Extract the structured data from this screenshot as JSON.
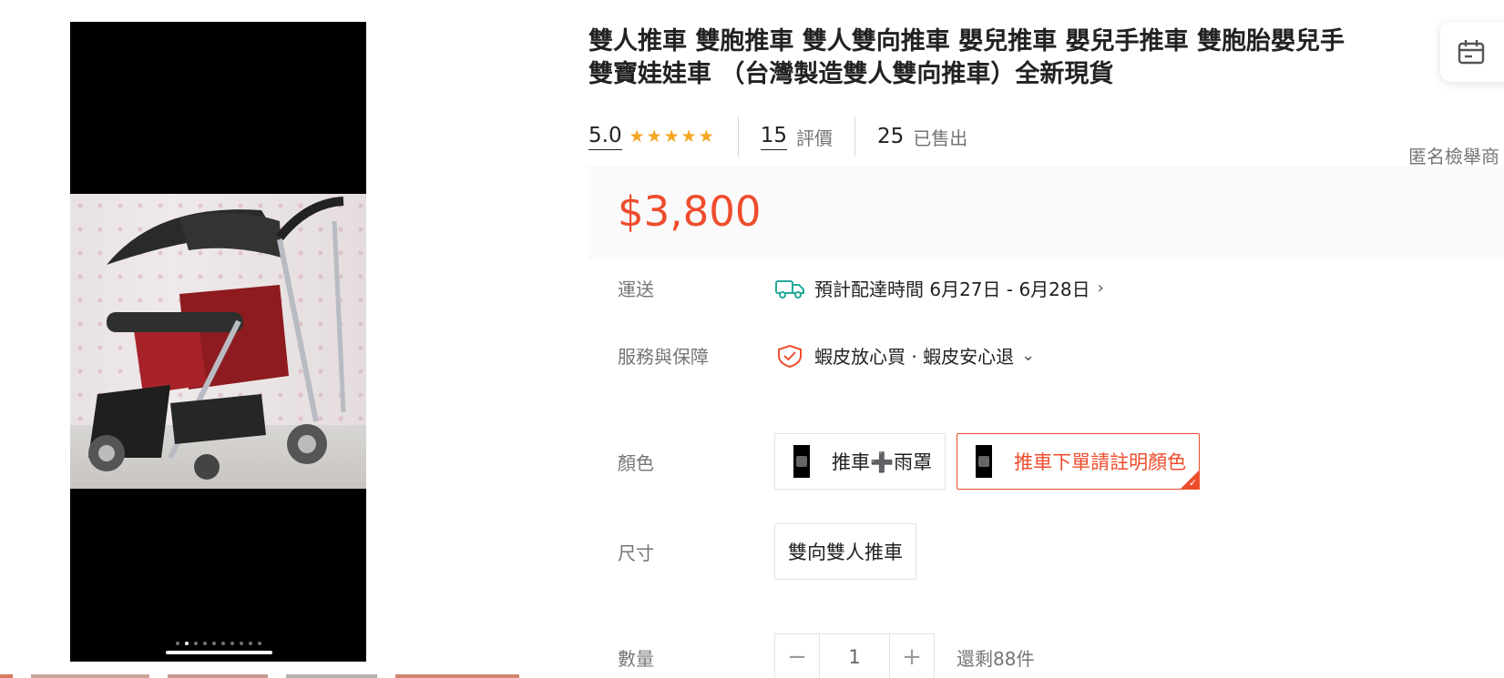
{
  "product": {
    "title_line1": "雙人推車 雙胞推車 雙人雙向推車 嬰兒推車 嬰兒手推車 雙胞胎嬰兒手",
    "title_line2": "雙寶娃娃車 （台灣製造雙人雙向推車）全新現貨",
    "rating": "5.0",
    "stars": "★★★★★",
    "reviews_count": "15",
    "reviews_label": "評價",
    "sold_count": "25",
    "sold_label": "已售出",
    "report_link": "匿名檢舉商",
    "price": "$3,800"
  },
  "shipping": {
    "label": "運送",
    "text": "預計配達時間 6月27日 - 6月28日",
    "icon": "truck-icon"
  },
  "service": {
    "label": "服務與保障",
    "text": "蝦皮放心買 · 蝦皮安心退",
    "icon": "shield-icon"
  },
  "color": {
    "label": "顏色",
    "options": [
      {
        "label": "推車➕雨罩",
        "selected": false
      },
      {
        "label": "推車下單請註明顏色",
        "selected": true
      }
    ]
  },
  "size": {
    "label": "尺寸",
    "options": [
      {
        "label": "雙向雙人推車"
      }
    ]
  },
  "quantity": {
    "label": "數量",
    "value": "1",
    "minus": "−",
    "plus": "+",
    "stock": "還剩88件"
  },
  "gallery": {
    "slide_count": 10,
    "active_slide": 2
  },
  "colors": {
    "accent": "#ee4d2d",
    "star": "#f5a623",
    "teal": "#26aa99"
  }
}
